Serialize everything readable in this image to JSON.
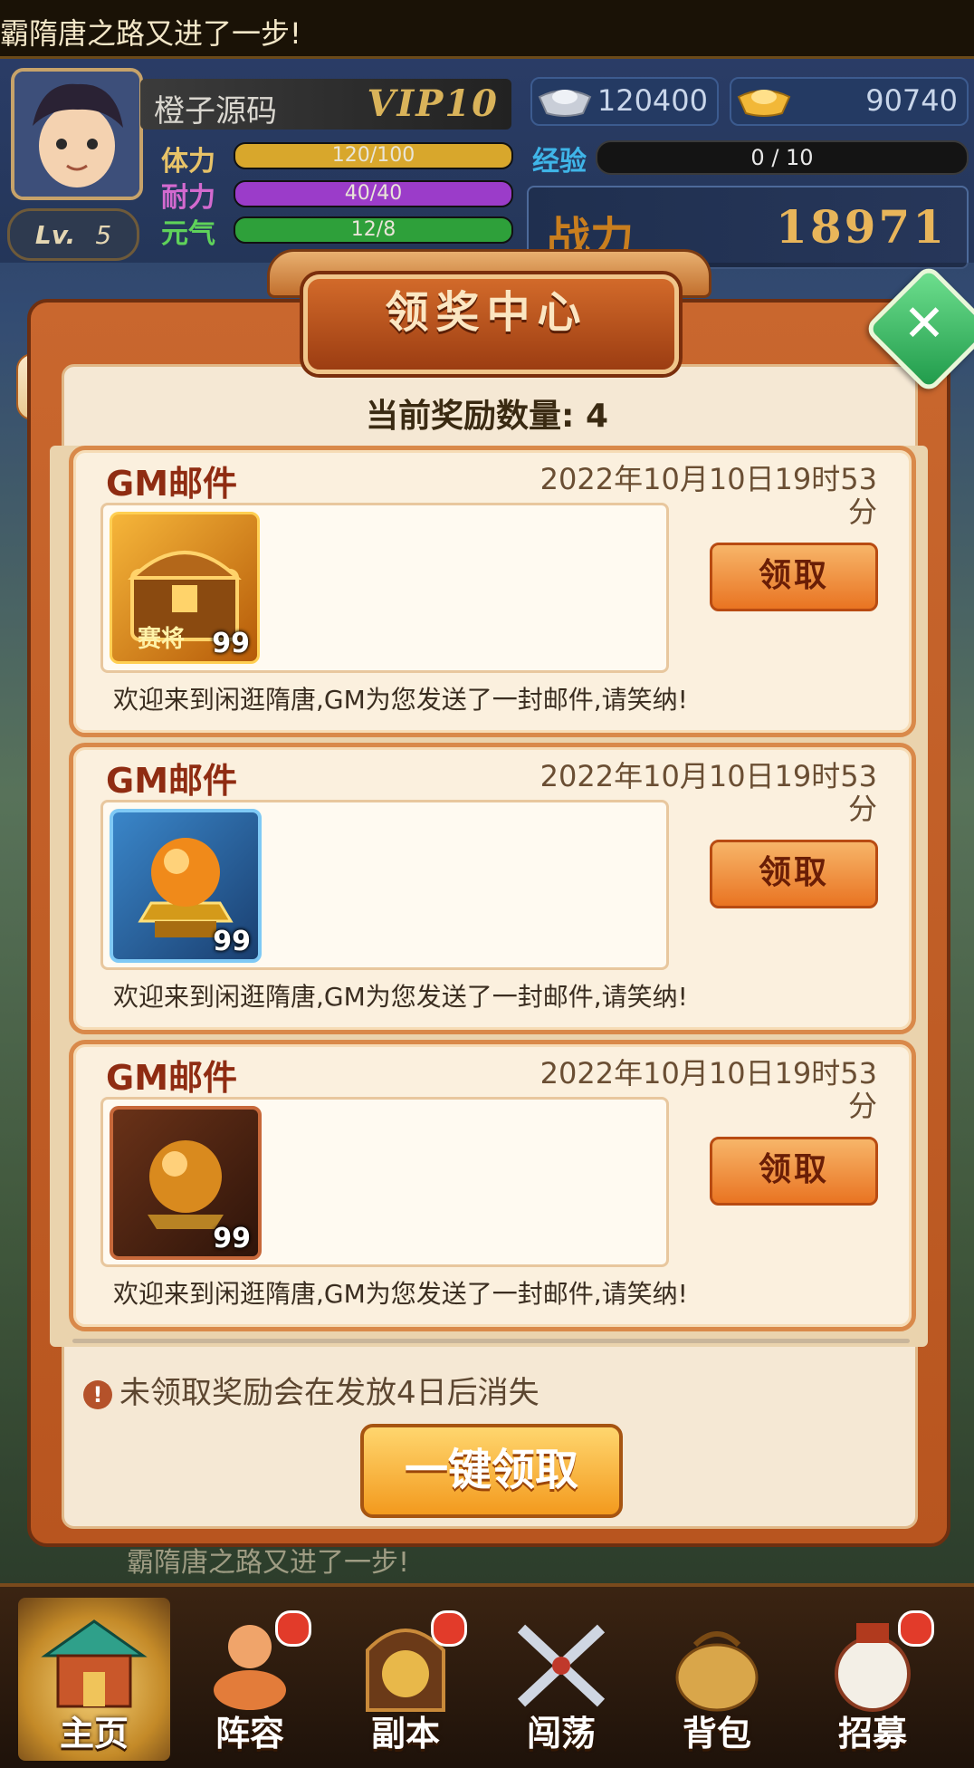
{
  "ticker": {
    "text": "霸隋唐之路又进了一步!"
  },
  "player": {
    "name": "橙子源码",
    "vip": "VIP10",
    "level_label": "Lv.",
    "level": "5"
  },
  "stats": [
    {
      "label": "体力",
      "value": "120/100",
      "fill": 1.0,
      "color": "#d8a72c",
      "label_color": "#e8c368"
    },
    {
      "label": "耐力",
      "value": "40/40",
      "fill": 1.0,
      "color": "#9b3cc9",
      "label_color": "#d36acf"
    },
    {
      "label": "元气",
      "value": "12/8",
      "fill": 1.0,
      "color": "#2ea03a",
      "label_color": "#5fd25a"
    }
  ],
  "currency": {
    "silver": "120400",
    "gold": "90740"
  },
  "exp": {
    "label": "经验",
    "value": "0 / 10"
  },
  "power": {
    "label": "战力",
    "value": "18971"
  },
  "modal": {
    "title": "领奖中心",
    "count_label": "当前奖励数量:",
    "count": "4",
    "mails": [
      {
        "title": "GM邮件",
        "date": "2022年10月10日19时53分",
        "qty": "99",
        "item_icon": "treasure-chest-icon",
        "claim": "领取",
        "message": "欢迎来到闲逛隋唐,GM为您发送了一封邮件,请笑纳!"
      },
      {
        "title": "GM邮件",
        "date": "2022年10月10日19时53分",
        "qty": "99",
        "item_icon": "fire-orb-icon",
        "claim": "领取",
        "message": "欢迎来到闲逛隋唐,GM为您发送了一封邮件,请笑纳!"
      },
      {
        "title": "GM邮件",
        "date": "2022年10月10日19时53分",
        "qty": "99",
        "item_icon": "golden-orb-icon",
        "claim": "领取",
        "message": "欢迎来到闲逛隋唐,GM为您发送了一封邮件,请笑纳!"
      }
    ],
    "warning": "未领取奖励会在发放4日后消失",
    "one_key_claim": "一键领取"
  },
  "under_ticker": "霸隋唐之路又进了一步!",
  "nav": [
    {
      "label": "主页",
      "icon": "home-icon",
      "active": true,
      "badge": false
    },
    {
      "label": "阵容",
      "icon": "lineup-icon",
      "active": false,
      "badge": true
    },
    {
      "label": "副本",
      "icon": "dungeon-icon",
      "active": false,
      "badge": true
    },
    {
      "label": "闯荡",
      "icon": "crossed-swords-icon",
      "active": false,
      "badge": false
    },
    {
      "label": "背包",
      "icon": "bag-icon",
      "active": false,
      "badge": false
    },
    {
      "label": "招募",
      "icon": "recruit-icon",
      "active": false,
      "badge": true
    }
  ]
}
